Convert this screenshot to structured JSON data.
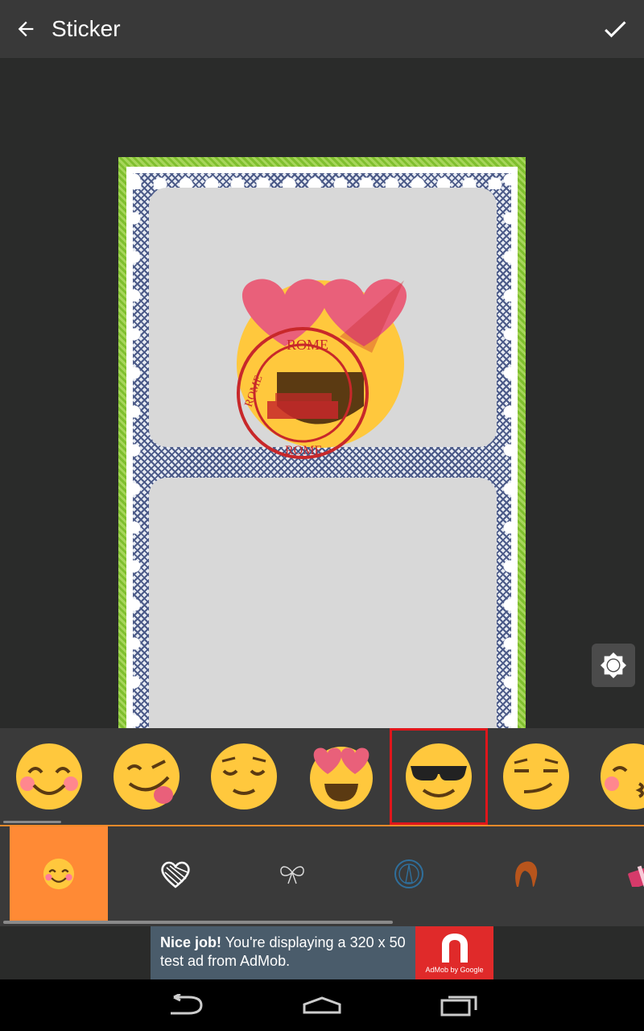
{
  "toolbar": {
    "title": "Sticker",
    "back_icon": "arrow-back-icon",
    "confirm_icon": "check-icon"
  },
  "canvas": {
    "sticker_stamp_top": "ROME",
    "sticker_stamp_left": "ROME",
    "sticker_stamp_bottom": "ROME",
    "brightness_icon": "brightness-icon"
  },
  "emoji_stickers": [
    {
      "name": "smiling-blush-emoji",
      "selected": false
    },
    {
      "name": "tongue-wink-emoji",
      "selected": false
    },
    {
      "name": "relieved-emoji",
      "selected": false
    },
    {
      "name": "heart-eyes-emoji",
      "selected": false
    },
    {
      "name": "sunglasses-emoji",
      "selected": true
    },
    {
      "name": "smirk-emoji",
      "selected": false
    },
    {
      "name": "kissing-emoji",
      "selected": false
    }
  ],
  "categories": [
    {
      "name": "emoji-category",
      "active": true
    },
    {
      "name": "heart-category",
      "active": false
    },
    {
      "name": "bow-category",
      "active": false
    },
    {
      "name": "stamp-category",
      "active": false
    },
    {
      "name": "hair-category",
      "active": false
    },
    {
      "name": "gift-category",
      "active": false
    }
  ],
  "ad": {
    "headline": "Nice job!",
    "body": " You're displaying a 320 x 50 test ad from AdMob.",
    "logo_caption": "AdMob by Google"
  },
  "colors": {
    "accent": "#ff8a35",
    "selection": "#e0161b",
    "toolbar": "#393939"
  }
}
